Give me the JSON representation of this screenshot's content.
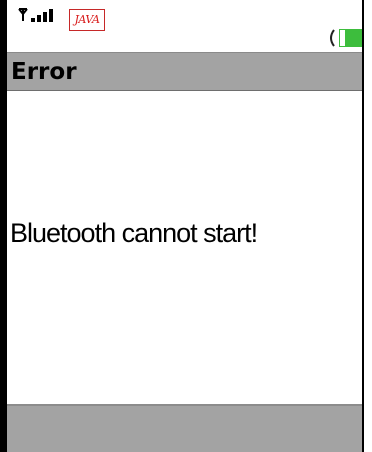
{
  "status_bar": {
    "signal_icon": "signal-strength-icon",
    "java_icon": "java-app-icon",
    "java_label": "JAVA",
    "battery_icon": "battery-icon",
    "battery_color": "#3dbd3d"
  },
  "title_bar": {
    "title": "Error"
  },
  "content": {
    "message": "Bluetooth cannot start!"
  },
  "colors": {
    "title_bar_bg": "#a3a3a3",
    "softkey_bar_bg": "#a3a3a3",
    "java_red": "#d81b1b"
  }
}
